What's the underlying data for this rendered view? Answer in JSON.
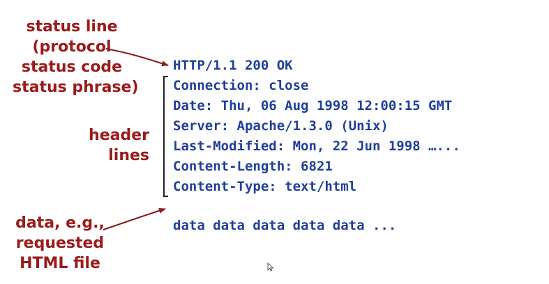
{
  "colors": {
    "annotation": "#9b1a1a",
    "code": "#1f3f9a",
    "bracket": "#222222",
    "arrow": "#8b1a1a"
  },
  "annotations": {
    "status_line": "status line\n(protocol\nstatus code\nstatus phrase)",
    "header_lines": "header\nlines",
    "data": "data, e.g.,\nrequested\nHTML file"
  },
  "response": {
    "status_line": "HTTP/1.1 200 OK",
    "headers": [
      "Connection: close",
      "Date: Thu, 06 Aug 1998 12:00:15 GMT",
      "Server: Apache/1.3.0 (Unix)",
      "Last-Modified: Mon, 22 Jun 1998 …...",
      "Content-Length: 6821",
      "Content-Type: text/html"
    ],
    "body": "data data data data data ..."
  },
  "icons": {
    "cursor": "mouse-pointer-icon"
  }
}
